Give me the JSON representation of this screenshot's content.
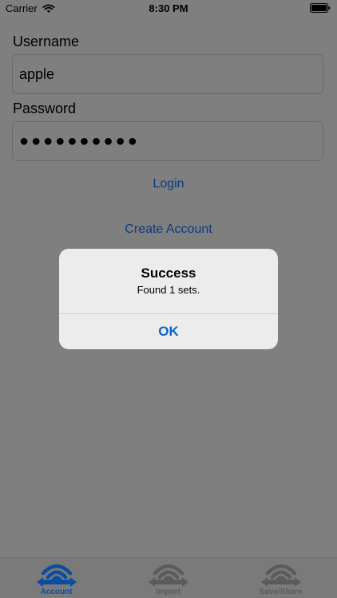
{
  "status": {
    "carrier": "Carrier",
    "time": "8:30 PM"
  },
  "form": {
    "username_label": "Username",
    "username_value": "apple",
    "password_label": "Password",
    "password_mask": "●●●●●●●●●●",
    "login_label": "Login",
    "create_account_label": "Create Account"
  },
  "alert": {
    "title": "Success",
    "message": "Found 1 sets.",
    "ok_label": "OK"
  },
  "tabs": [
    {
      "label": "Account",
      "active": true,
      "icon": "wifi-arrows-icon"
    },
    {
      "label": "Import",
      "active": false,
      "icon": "wifi-arrows-icon"
    },
    {
      "label": "Save/Share",
      "active": false,
      "icon": "wifi-arrows-icon"
    }
  ],
  "colors": {
    "dim_background": "#7f7f7f",
    "link_blue": "#083b7d",
    "alert_blue": "#0a63c9",
    "active_tab_blue": "#0b4d9e",
    "inactive_tab_gray": "#5b5b5b"
  }
}
